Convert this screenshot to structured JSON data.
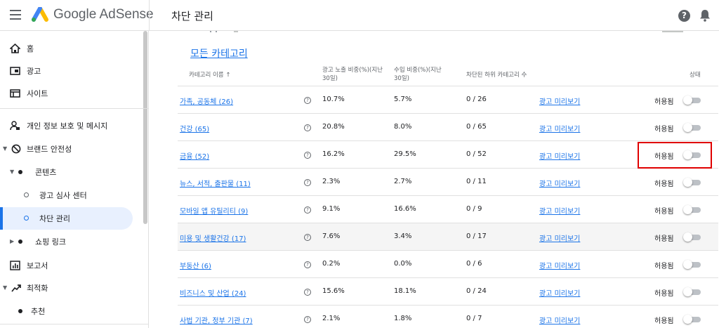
{
  "app": {
    "brand": "Google AdSense",
    "page_title": "차단 관리"
  },
  "sidebar": {
    "items": [
      {
        "label": "홈"
      },
      {
        "label": "광고"
      },
      {
        "label": "사이트"
      },
      {
        "label": "개인 정보 보호 및 메시지"
      },
      {
        "label": "브랜드 안전성"
      },
      {
        "label": "콘텐츠"
      },
      {
        "label": "광고 심사 센터"
      },
      {
        "label": "차단 관리"
      },
      {
        "label": "쇼핑 링크"
      },
      {
        "label": "보고서"
      },
      {
        "label": "최적화"
      },
      {
        "label": "추천"
      }
    ]
  },
  "main": {
    "section_title": "모든 카테고리",
    "columns": {
      "name": "카테고리 이름 ↑",
      "impressions_l1": "광고 노출 비중(%)(지난",
      "impressions_l2": "30일)",
      "revenue_l1": "수입 비중(%)(지난",
      "revenue_l2": "30일)",
      "blocked": "차단된 하위 카테고리 수",
      "status": "상태"
    },
    "preview_label": "광고 미리보기",
    "status_label": "허용됨",
    "rows": [
      {
        "name": "가족, 공동체 (26)",
        "impressions": "10.7%",
        "revenue": "5.7%",
        "blocked": "0 / 26",
        "preview": "광고 미리보기",
        "status": "허용됨"
      },
      {
        "name": "건강 (65)",
        "impressions": "20.8%",
        "revenue": "8.0%",
        "blocked": "0 / 65",
        "preview": "광고 미리보기",
        "status": "허용됨"
      },
      {
        "name": "금융 (52)",
        "impressions": "16.2%",
        "revenue": "29.5%",
        "blocked": "0 / 52",
        "preview": "광고 미리보기",
        "status": "허용됨"
      },
      {
        "name": "뉴스, 서적, 출판물 (11)",
        "impressions": "2.3%",
        "revenue": "2.7%",
        "blocked": "0 / 11",
        "preview": "광고 미리보기",
        "status": "허용됨"
      },
      {
        "name": "모바일 앱 유틸리티 (9)",
        "impressions": "9.1%",
        "revenue": "16.6%",
        "blocked": "0 / 9",
        "preview": "광고 미리보기",
        "status": "허용됨"
      },
      {
        "name": "미용 및 생활건강 (17)",
        "impressions": "7.6%",
        "revenue": "3.4%",
        "blocked": "0 / 17",
        "preview": "광고 미리보기",
        "status": "허용됨"
      },
      {
        "name": "부동산 (6)",
        "impressions": "0.2%",
        "revenue": "0.0%",
        "blocked": "0 / 6",
        "preview": "광고 미리보기",
        "status": "허용됨"
      },
      {
        "name": "비즈니스 및 산업 (24)",
        "impressions": "15.6%",
        "revenue": "18.1%",
        "blocked": "0 / 24",
        "preview": "광고 미리보기",
        "status": "허용됨"
      },
      {
        "name": "사법 기관, 정부 기관 (7)",
        "impressions": "2.1%",
        "revenue": "1.8%",
        "blocked": "0 / 7",
        "preview": "광고 미리보기",
        "status": "허용됨"
      }
    ]
  },
  "colors": {
    "link": "#1a73e8",
    "highlight": "#e00000",
    "active_nav": "#e8f0fe"
  },
  "icons": {
    "menu": "hamburger-icon",
    "logo": "adsense-logo-icon",
    "help": "help-icon",
    "notifications": "bell-icon"
  }
}
